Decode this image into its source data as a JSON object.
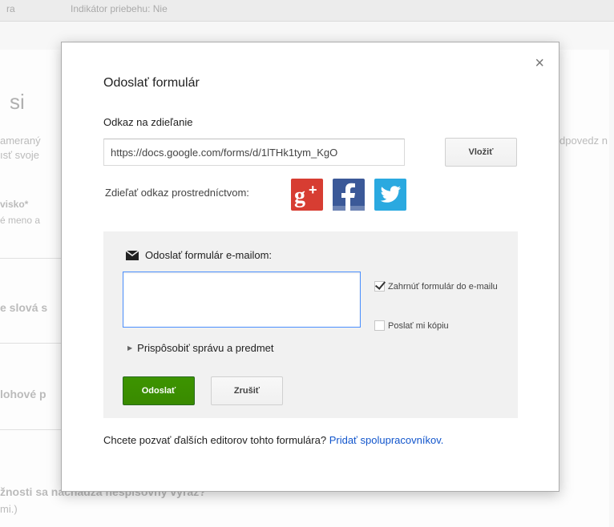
{
  "background": {
    "top_left": "ra",
    "top_indicator": "Indikátor priebehu: Nie",
    "heading": "si",
    "line1": "ameraný",
    "line2": "ısť svoje",
    "field1_label": "visko*",
    "field1_hint": "é meno a",
    "field2_label": "e slová s",
    "field3_label": "lohové p",
    "question": "žnosti sa nachádza nespisovný výraz?",
    "question_hint": "mi.)",
    "right_text": "dpovedz n"
  },
  "dialog": {
    "close_symbol": "×",
    "title": "Odoslať formulár",
    "share_link_label": "Odkaz na zdieľanie",
    "share_link_value": "https://docs.google.com/forms/d/1lTHk1tym_KgO",
    "insert_button": "Vložiť",
    "share_via_label": "Zdieľať odkaz prostredníctvom:",
    "social": [
      "Google+",
      "Facebook",
      "Twitter"
    ],
    "email": {
      "heading": "Odoslať formulár e-mailom:",
      "recipients_value": "",
      "include_form_label": "Zahrnúť formulár do e-mailu",
      "include_form_checked": true,
      "send_copy_label": "Poslať mi kópiu",
      "send_copy_checked": false,
      "customize_label": "Prispôsobiť správu a predmet",
      "send_button": "Odoslať",
      "cancel_button": "Zrušiť"
    },
    "footer_text": "Chcete pozvať ďalších editorov tohto formulára?",
    "footer_link": "Pridať spolupracovníkov."
  },
  "colors": {
    "send_green": "#3d9400",
    "link_blue": "#1155cc",
    "gplus_red": "#d73d32",
    "facebook_blue": "#3b5998",
    "twitter_blue": "#2aa9e0",
    "focus_blue": "#4d90fe"
  },
  "icons": {
    "close": "close-icon",
    "email": "envelope-icon",
    "gplus": "google-plus-icon",
    "facebook": "facebook-icon",
    "twitter": "twitter-icon",
    "expand": "triangle-right-icon"
  }
}
